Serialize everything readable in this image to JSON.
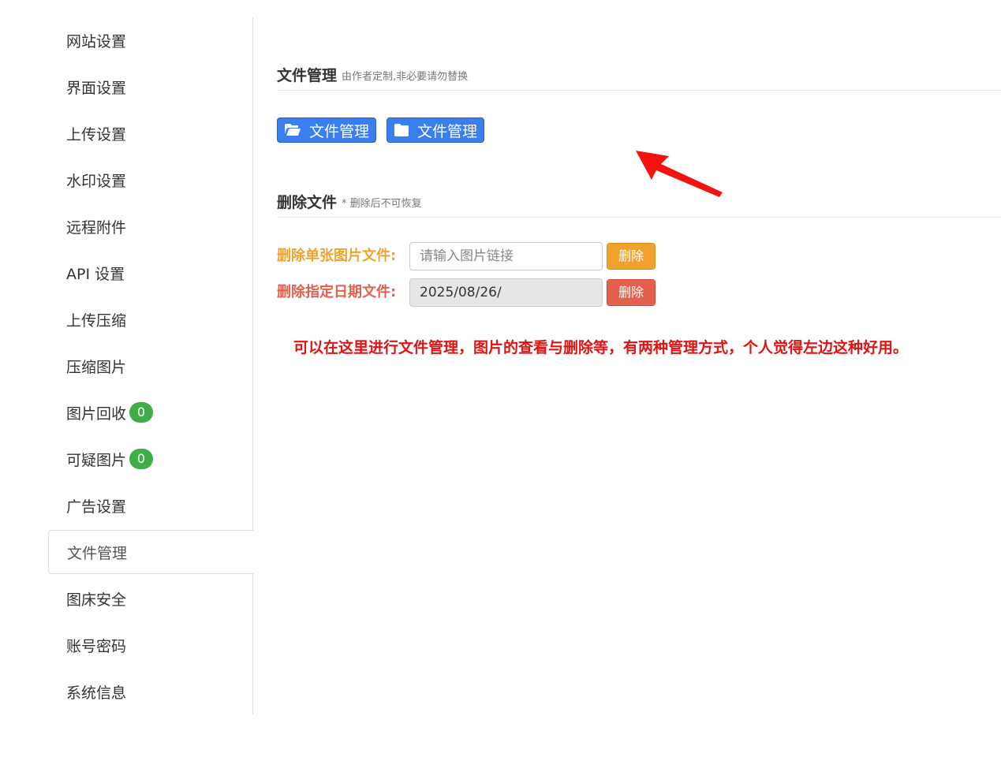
{
  "sidebar": {
    "items": [
      {
        "label": "网站设置"
      },
      {
        "label": "界面设置"
      },
      {
        "label": "上传设置"
      },
      {
        "label": "水印设置"
      },
      {
        "label": "远程附件"
      },
      {
        "label": "API 设置"
      },
      {
        "label": "上传压缩"
      },
      {
        "label": "压缩图片"
      },
      {
        "label": "图片回收",
        "badge": "0"
      },
      {
        "label": "可疑图片",
        "badge": "0"
      },
      {
        "label": "广告设置"
      },
      {
        "label": "文件管理",
        "active": true
      },
      {
        "label": "图床安全"
      },
      {
        "label": "账号密码"
      },
      {
        "label": "系统信息"
      }
    ],
    "badge_color": "#3fae49"
  },
  "file_manage": {
    "title": "文件管理",
    "note": "由作者定制,非必要请勿替换",
    "buttons": [
      {
        "label": "文件管理",
        "icon": "folder-open-icon"
      },
      {
        "label": "文件管理",
        "icon": "folder-icon"
      }
    ],
    "button_color": "#3a7ef0"
  },
  "delete_files": {
    "title": "删除文件",
    "note": "* 删除后不可恢复",
    "single": {
      "label": "删除单张图片文件:",
      "placeholder": "请输入图片链接",
      "button": "删除",
      "color": "#f0a22e"
    },
    "by_date": {
      "label": "删除指定日期文件:",
      "value": "2025/08/26/",
      "button": "删除",
      "color": "#e3604c"
    }
  },
  "annotation": {
    "text": "可以在这里进行文件管理，图片的查看与删除等，有两种管理方式，个人觉得左边这种好用。",
    "color": "#e31212"
  }
}
